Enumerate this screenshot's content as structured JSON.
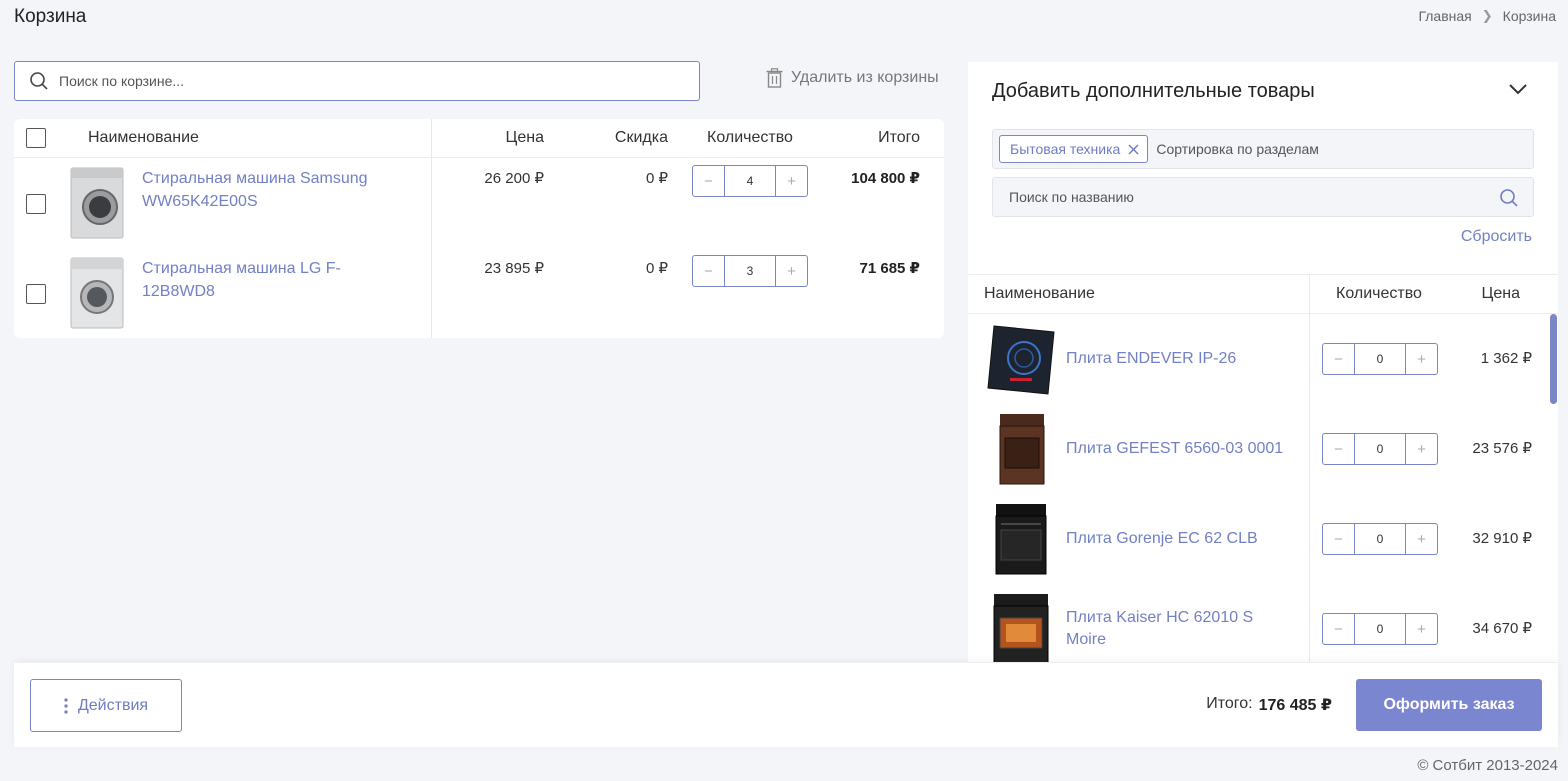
{
  "page": {
    "title": "Корзина"
  },
  "breadcrumb": {
    "home": "Главная",
    "current": "Корзина"
  },
  "cart_search": {
    "placeholder": "Поиск по корзине..."
  },
  "delete_label": "Удалить из корзины",
  "cart_table": {
    "headers": {
      "name": "Наименование",
      "price": "Цена",
      "discount": "Скидка",
      "quantity": "Количество",
      "total": "Итого"
    },
    "rows": [
      {
        "name": "Стиральная машина Samsung WW65K42E00S",
        "price": "26 200 ₽",
        "discount": "0 ₽",
        "qty": "4",
        "total": "104 800 ₽"
      },
      {
        "name": "Стиральная машина LG F-12B8WD8",
        "price": "23 895 ₽",
        "discount": "0 ₽",
        "qty": "3",
        "total": "71 685 ₽"
      }
    ]
  },
  "add_panel": {
    "title": "Добавить дополнительные товары",
    "tag": "Бытовая техника",
    "sort_placeholder": "Сортировка по разделам",
    "search_placeholder": "Поиск по названию",
    "reset": "Сбросить",
    "headers": {
      "name": "Наименование",
      "quantity": "Количество",
      "price": "Цена"
    },
    "items": [
      {
        "name": "Плита ENDEVER IP-26",
        "qty": "0",
        "price": "1 362 ₽"
      },
      {
        "name": "Плита GEFEST 6560-03 0001",
        "qty": "0",
        "price": "23 576 ₽"
      },
      {
        "name": "Плита Gorenje EC 62 CLB",
        "qty": "0",
        "price": "32 910 ₽"
      },
      {
        "name": "Плита Kaiser HC 62010 S Moire",
        "qty": "0",
        "price": "34 670 ₽"
      }
    ]
  },
  "footer": {
    "actions_label": "Действия",
    "total_label": "Итого:",
    "total_value": "176 485 ₽",
    "order_label": "Оформить заказ"
  },
  "copyright": "© Сотбит 2013-2024",
  "colors": {
    "accent": "#7a86c6",
    "link": "#7280c4",
    "button": "#7a86d0"
  }
}
